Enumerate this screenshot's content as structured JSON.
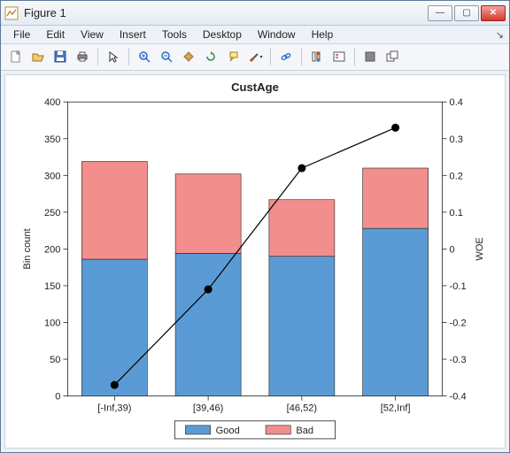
{
  "window": {
    "title": "Figure 1"
  },
  "menu": {
    "items": [
      "File",
      "Edit",
      "View",
      "Insert",
      "Tools",
      "Desktop",
      "Window",
      "Help"
    ]
  },
  "toolbar": {
    "icons": [
      "new-file-icon",
      "open-icon",
      "save-icon",
      "print-icon",
      "sep",
      "pointer-icon",
      "sep",
      "zoom-in-icon",
      "zoom-out-icon",
      "pan-icon",
      "rotate-icon",
      "datatip-icon",
      "brush-icon",
      "sep",
      "link-icon",
      "sep",
      "colorbar-icon",
      "legend-icon",
      "sep",
      "dock-icon",
      "undock-icon"
    ]
  },
  "chart_data": {
    "type": "bar",
    "title": "CustAge",
    "xlabel": "",
    "ylabel_left": "Bin count",
    "ylabel_right": "WOE",
    "categories": [
      "[-Inf,39)",
      "[39,46)",
      "[46,52)",
      "[52,Inf]"
    ],
    "series": [
      {
        "name": "Good",
        "values": [
          186,
          194,
          190,
          228
        ],
        "color": "#5b9bd5"
      },
      {
        "name": "Bad",
        "values": [
          133,
          108,
          77,
          82
        ],
        "color": "#f28e8c"
      }
    ],
    "line_series": {
      "name": "WOE",
      "values": [
        -0.37,
        -0.11,
        0.22,
        0.33
      ],
      "color": "#000"
    },
    "ylim_left": [
      0,
      400
    ],
    "yticks_left": [
      0,
      50,
      100,
      150,
      200,
      250,
      300,
      350,
      400
    ],
    "ylim_right": [
      -0.4,
      0.4
    ],
    "yticks_right": [
      -0.4,
      -0.3,
      -0.2,
      -0.1,
      0,
      0.1,
      0.2,
      0.3,
      0.4
    ],
    "legend": [
      "Good",
      "Bad"
    ]
  }
}
